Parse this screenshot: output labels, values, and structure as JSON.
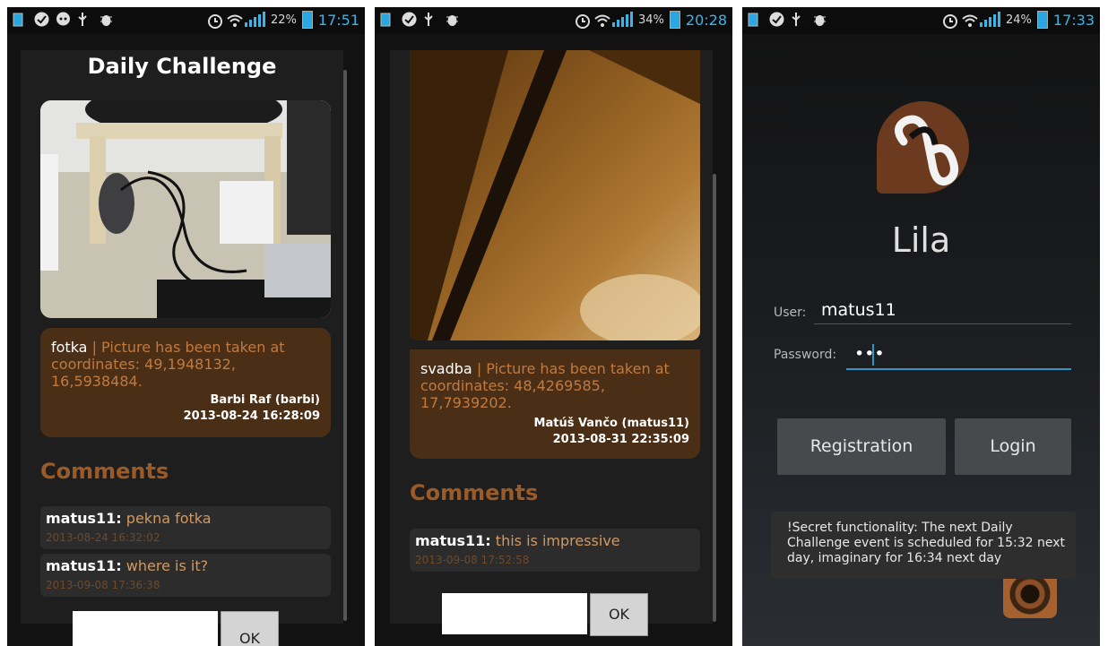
{
  "panel1": {
    "status": {
      "battery": "22%",
      "time": "17:51"
    },
    "title": "Daily Challenge",
    "post": {
      "name": "fotka",
      "separator": " | ",
      "text": "Picture has been taken at coordinates: 49,1948132, 16,5938484.",
      "author": "Barbi Raf (barbi)",
      "date": "2013-08-24 16:28:09"
    },
    "comments_heading": "Comments",
    "comments": [
      {
        "user": "matus11:",
        "text": "pekna fotka",
        "date": "2013-08-24 16:32:02"
      },
      {
        "user": "matus11:",
        "text": "where is it?",
        "date": "2013-09-08 17:36:38"
      }
    ],
    "ok_label": "OK"
  },
  "panel2": {
    "status": {
      "battery": "34%",
      "time": "20:28"
    },
    "post": {
      "name": "svadba",
      "separator": " | ",
      "text": "Picture has been taken at coordinates: 48,4269585, 17,7939202.",
      "author": "Matúš Vančo (matus11)",
      "date": "2013-08-31 22:35:09"
    },
    "comments_heading": "Comments",
    "comments": [
      {
        "user": "matus11:",
        "text": "this is impressive",
        "date": "2013-09-08 17:52:58"
      }
    ],
    "ok_label": "OK"
  },
  "panel3": {
    "status": {
      "battery": "24%",
      "time": "17:33"
    },
    "app_name": "Lila",
    "user_label": "User:",
    "user_value": "matus11",
    "password_label": "Password:",
    "password_value": "•••",
    "registration_label": "Registration",
    "login_label": "Login",
    "toast": "!Secret functionality: The next Daily Challenge event is scheduled for 15:32 next day, imaginary for 16:34 next day"
  },
  "colors": {
    "accent_blue": "#38b6ea",
    "brown": "#4a2e16",
    "comment_text": "#d29860"
  }
}
